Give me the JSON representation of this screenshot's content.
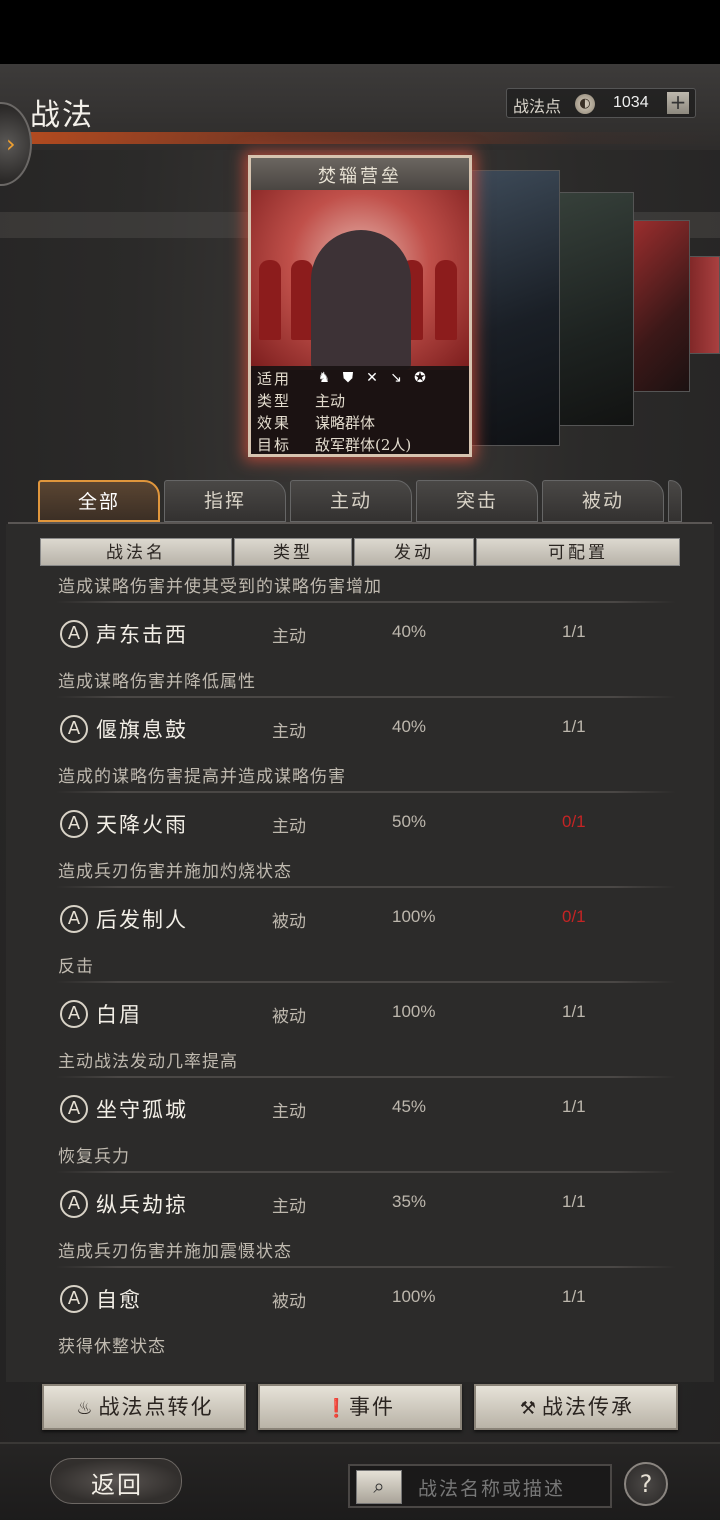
{
  "header": {
    "title": "战法",
    "points_label": "战法点",
    "points_value": "1034",
    "points_add": "+"
  },
  "featured": {
    "name": "焚辎营垒",
    "rows": [
      {
        "key": "适用",
        "value": ""
      },
      {
        "key": "类型",
        "value": "主动"
      },
      {
        "key": "效果",
        "value": "谋略群体"
      },
      {
        "key": "目标",
        "value": "敌军群体(2人)"
      }
    ],
    "unit_icons": [
      "cavalry-icon",
      "shield-icon",
      "crossbow-icon",
      "spear-icon",
      "chariot-icon"
    ]
  },
  "tabs": [
    "全部",
    "指挥",
    "主动",
    "突击",
    "被动"
  ],
  "columns": [
    "战法名",
    "类型",
    "发动",
    "可配置"
  ],
  "partial_row_desc": "造成谋略伤害并使其受到的谋略伤害增加",
  "skills": [
    {
      "grade": "A",
      "name": "声东击西",
      "type": "主动",
      "rate": "40%",
      "slots": "1/1",
      "desc": "造成谋略伤害并降低属性"
    },
    {
      "grade": "A",
      "name": "偃旗息鼓",
      "type": "主动",
      "rate": "40%",
      "slots": "1/1",
      "desc": "造成的谋略伤害提高并造成谋略伤害"
    },
    {
      "grade": "A",
      "name": "天降火雨",
      "type": "主动",
      "rate": "50%",
      "slots": "0/1",
      "desc": "造成兵刃伤害并施加灼烧状态"
    },
    {
      "grade": "A",
      "name": "后发制人",
      "type": "被动",
      "rate": "100%",
      "slots": "0/1",
      "desc": "反击"
    },
    {
      "grade": "A",
      "name": "白眉",
      "type": "被动",
      "rate": "100%",
      "slots": "1/1",
      "desc": "主动战法发动几率提高"
    },
    {
      "grade": "A",
      "name": "坐守孤城",
      "type": "主动",
      "rate": "45%",
      "slots": "1/1",
      "desc": "恢复兵力"
    },
    {
      "grade": "A",
      "name": "纵兵劫掠",
      "type": "主动",
      "rate": "35%",
      "slots": "1/1",
      "desc": "造成兵刃伤害并施加震慑状态"
    },
    {
      "grade": "A",
      "name": "自愈",
      "type": "被动",
      "rate": "100%",
      "slots": "1/1",
      "desc": "获得休整状态"
    }
  ],
  "buttons": {
    "convert": "战法点转化",
    "events": "事件",
    "inherit": "战法传承"
  },
  "footer": {
    "back": "返回",
    "search_placeholder": "战法名称或描述",
    "help": "?"
  },
  "colors": {
    "accent": "#e0963c",
    "unavailable": "#c42424"
  }
}
